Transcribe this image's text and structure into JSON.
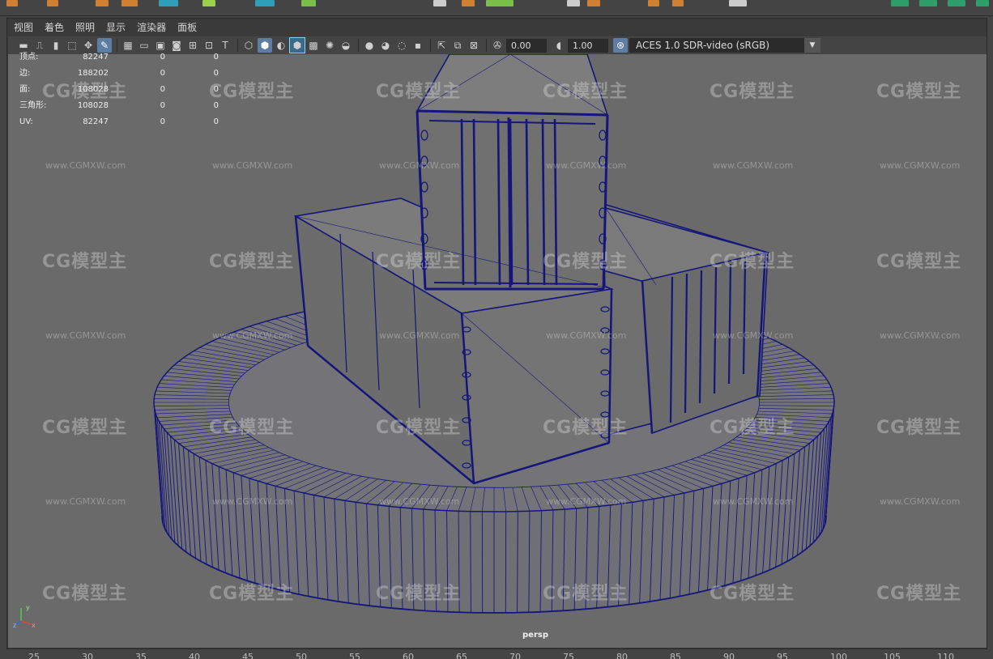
{
  "panel_menu": [
    "视图",
    "着色",
    "照明",
    "显示",
    "渲染器",
    "面板"
  ],
  "toolbar": {
    "exposure_value": "0.00",
    "gamma_value": "1.00",
    "color_space": "ACES 1.0 SDR-video (sRGB)"
  },
  "hud": {
    "rows": [
      {
        "label": "顶点:",
        "v1": "82247",
        "v2": "0",
        "v3": "0"
      },
      {
        "label": "边:",
        "v1": "188202",
        "v2": "0",
        "v3": "0"
      },
      {
        "label": "面:",
        "v1": "108028",
        "v2": "0",
        "v3": "0"
      },
      {
        "label": "三角形:",
        "v1": "108028",
        "v2": "0",
        "v3": "0"
      },
      {
        "label": "UV:",
        "v1": "82247",
        "v2": "0",
        "v3": "0"
      }
    ]
  },
  "camera_label": "persp",
  "watermark": {
    "logo": "CG模型主",
    "url": "www.CGMXW.com"
  },
  "axis": {
    "y": "y",
    "x": "x",
    "z": "z"
  },
  "ruler": [
    "25",
    "30",
    "35",
    "40",
    "45",
    "50",
    "55",
    "60",
    "65",
    "70",
    "75",
    "80",
    "85",
    "90",
    "95",
    "100",
    "105",
    "110"
  ],
  "colors": {
    "viewport_bg": "#6a6a6a",
    "wireframe": "#15157a",
    "toolbar_accent": "#5d7da3"
  }
}
